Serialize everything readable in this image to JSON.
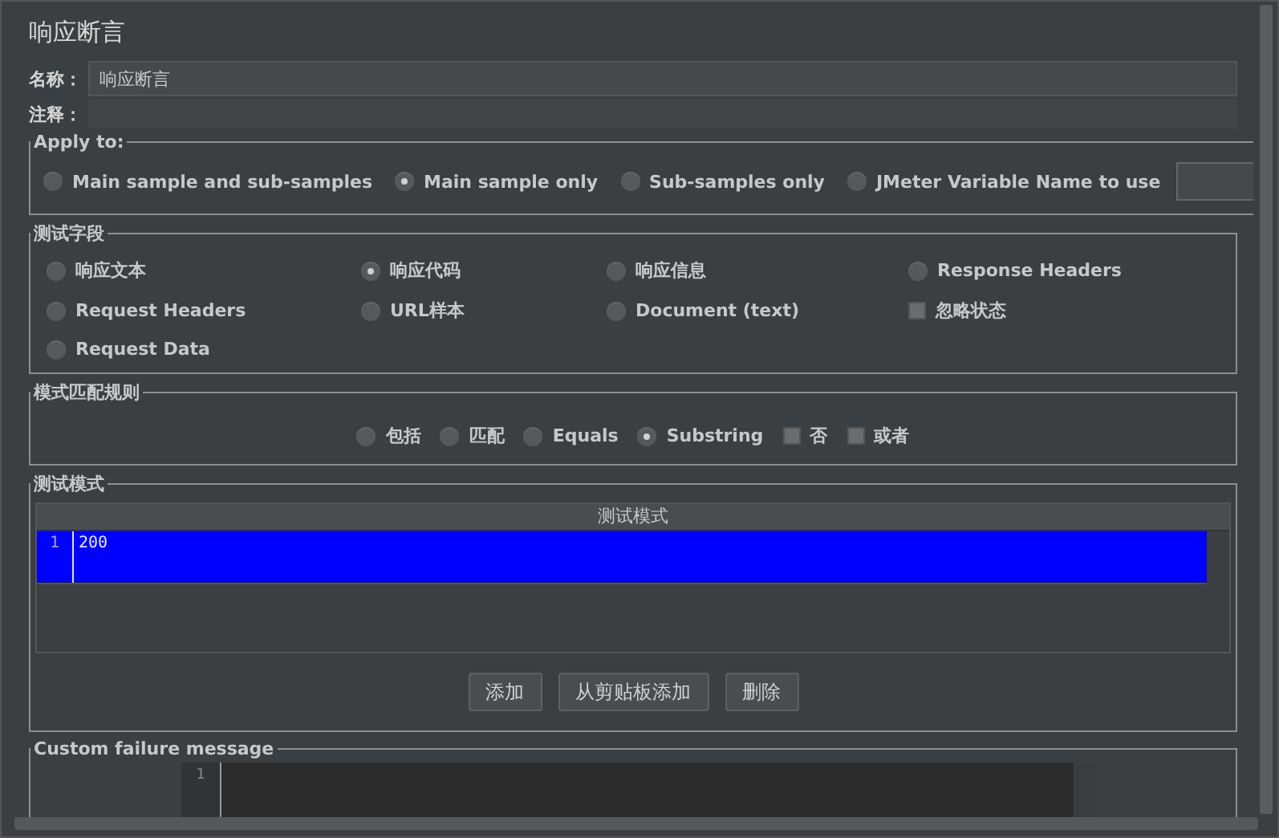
{
  "panel_title": "响应断言",
  "name": {
    "label": "名称：",
    "value": "响应断言"
  },
  "comment": {
    "label": "注释："
  },
  "apply_to": {
    "legend": "Apply to:",
    "options": [
      {
        "label": "Main sample and sub-samples",
        "selected": false
      },
      {
        "label": "Main sample only",
        "selected": true
      },
      {
        "label": "Sub-samples only",
        "selected": false
      },
      {
        "label": "JMeter Variable Name to use",
        "selected": false
      }
    ]
  },
  "test_field": {
    "legend": "测试字段",
    "options": [
      {
        "kind": "radio",
        "label": "响应文本",
        "selected": false
      },
      {
        "kind": "radio",
        "label": "响应代码",
        "selected": true
      },
      {
        "kind": "radio",
        "label": "响应信息",
        "selected": false
      },
      {
        "kind": "radio",
        "label": "Response Headers",
        "selected": false
      },
      {
        "kind": "radio",
        "label": "Request Headers",
        "selected": false
      },
      {
        "kind": "radio",
        "label": "URL样本",
        "selected": false
      },
      {
        "kind": "radio",
        "label": "Document (text)",
        "selected": false
      },
      {
        "kind": "checkbox",
        "label": "忽略状态",
        "checked": false
      },
      {
        "kind": "radio",
        "label": "Request Data",
        "selected": false
      }
    ]
  },
  "pattern_rules": {
    "legend": "模式匹配规则",
    "options": [
      {
        "kind": "radio",
        "label": "包括",
        "selected": false
      },
      {
        "kind": "radio",
        "label": "匹配",
        "selected": false
      },
      {
        "kind": "radio",
        "label": "Equals",
        "selected": false
      },
      {
        "kind": "radio",
        "label": "Substring",
        "selected": true
      },
      {
        "kind": "checkbox",
        "label": "否",
        "checked": false
      },
      {
        "kind": "checkbox",
        "label": "或者",
        "checked": false
      }
    ]
  },
  "test_patterns": {
    "legend": "测试模式",
    "column": "测试模式",
    "rows": [
      {
        "line": "1",
        "value": "200",
        "selected": true
      }
    ],
    "buttons": [
      "添加",
      "从剪贴板添加",
      "删除"
    ]
  },
  "failure_message": {
    "legend": "Custom failure message",
    "lines": [
      "1"
    ]
  }
}
